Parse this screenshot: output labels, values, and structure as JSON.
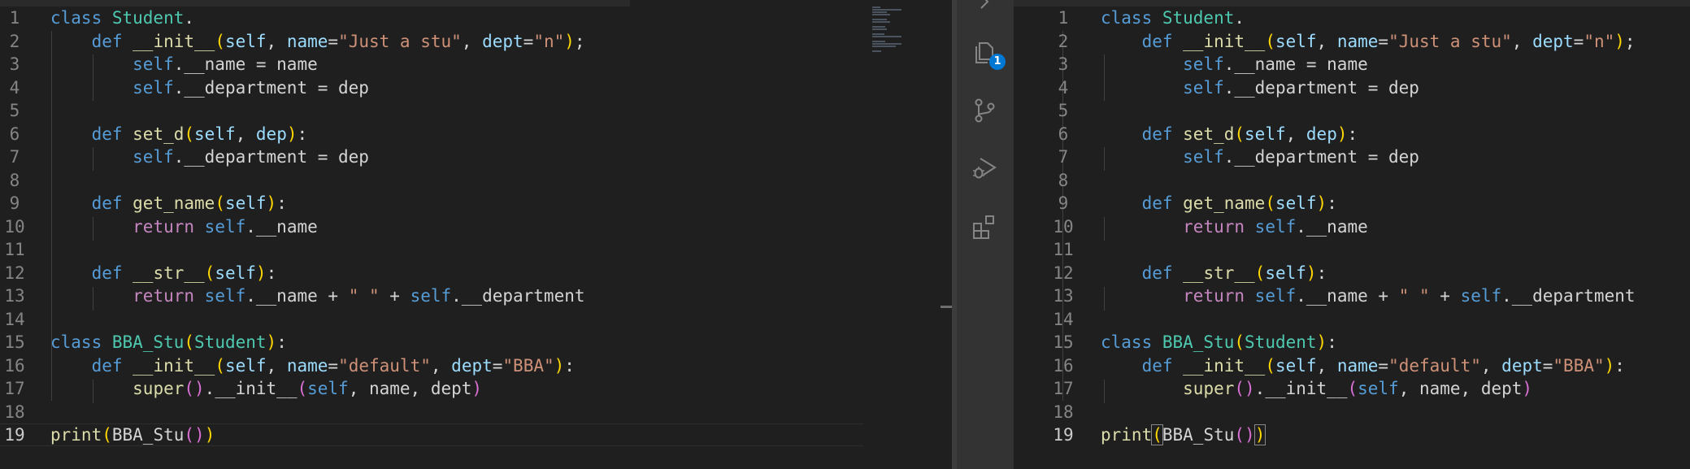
{
  "editor": {
    "lines": [
      {
        "n": "1",
        "t": [
          [
            "kw",
            "class "
          ],
          [
            "cls",
            "Student"
          ],
          [
            "",
            "."
          ]
        ]
      },
      {
        "n": "2",
        "t": [
          [
            "",
            "    "
          ],
          [
            "kw",
            "def "
          ],
          [
            "fn",
            "__init__"
          ],
          [
            "b1",
            "("
          ],
          [
            "prm",
            "self"
          ],
          [
            "",
            ", "
          ],
          [
            "prm",
            "name"
          ],
          [
            "",
            "="
          ],
          [
            "str",
            "\"Just a stu\""
          ],
          [
            "",
            ", "
          ],
          [
            "prm",
            "dept"
          ],
          [
            "",
            "="
          ],
          [
            "str",
            "\"n\""
          ],
          [
            "b1",
            ")"
          ],
          [
            "",
            ";"
          ]
        ]
      },
      {
        "n": "3",
        "t": [
          [
            "",
            "        "
          ],
          [
            "kw",
            "self"
          ],
          [
            "",
            ".__name = name"
          ]
        ]
      },
      {
        "n": "4",
        "t": [
          [
            "",
            "        "
          ],
          [
            "kw",
            "self"
          ],
          [
            "",
            ".__department = dep"
          ]
        ]
      },
      {
        "n": "5",
        "t": []
      },
      {
        "n": "6",
        "t": [
          [
            "",
            "    "
          ],
          [
            "kw",
            "def "
          ],
          [
            "fn",
            "set_d"
          ],
          [
            "b1",
            "("
          ],
          [
            "prm",
            "self"
          ],
          [
            "",
            ", "
          ],
          [
            "prm",
            "dep"
          ],
          [
            "b1",
            ")"
          ],
          [
            "",
            ":"
          ]
        ]
      },
      {
        "n": "7",
        "t": [
          [
            "",
            "        "
          ],
          [
            "kw",
            "self"
          ],
          [
            "",
            ".__department = dep"
          ]
        ]
      },
      {
        "n": "8",
        "t": []
      },
      {
        "n": "9",
        "t": [
          [
            "",
            "    "
          ],
          [
            "kw",
            "def "
          ],
          [
            "fn",
            "get_name"
          ],
          [
            "b1",
            "("
          ],
          [
            "prm",
            "self"
          ],
          [
            "b1",
            ")"
          ],
          [
            "",
            ":"
          ]
        ]
      },
      {
        "n": "10",
        "t": [
          [
            "",
            "        "
          ],
          [
            "ctl",
            "return "
          ],
          [
            "kw",
            "self"
          ],
          [
            "",
            ".__name"
          ]
        ]
      },
      {
        "n": "11",
        "t": []
      },
      {
        "n": "12",
        "t": [
          [
            "",
            "    "
          ],
          [
            "kw",
            "def "
          ],
          [
            "fn",
            "__str__"
          ],
          [
            "b1",
            "("
          ],
          [
            "prm",
            "self"
          ],
          [
            "b1",
            ")"
          ],
          [
            "",
            ":"
          ]
        ]
      },
      {
        "n": "13",
        "t": [
          [
            "",
            "        "
          ],
          [
            "ctl",
            "return "
          ],
          [
            "kw",
            "self"
          ],
          [
            "",
            ".__name + "
          ],
          [
            "str",
            "\" \""
          ],
          [
            "",
            " + "
          ],
          [
            "kw",
            "self"
          ],
          [
            "",
            ".__department"
          ]
        ]
      },
      {
        "n": "14",
        "t": []
      },
      {
        "n": "15",
        "t": [
          [
            "kw",
            "class "
          ],
          [
            "cls",
            "BBA_Stu"
          ],
          [
            "b1",
            "("
          ],
          [
            "cls",
            "Student"
          ],
          [
            "b1",
            ")"
          ],
          [
            "",
            ":"
          ]
        ]
      },
      {
        "n": "16",
        "t": [
          [
            "",
            "    "
          ],
          [
            "kw",
            "def "
          ],
          [
            "fn",
            "__init__"
          ],
          [
            "b1",
            "("
          ],
          [
            "prm",
            "self"
          ],
          [
            "",
            ", "
          ],
          [
            "prm",
            "name"
          ],
          [
            "",
            "="
          ],
          [
            "str",
            "\"default\""
          ],
          [
            "",
            ", "
          ],
          [
            "prm",
            "dept"
          ],
          [
            "",
            "="
          ],
          [
            "str",
            "\"BBA\""
          ],
          [
            "b1",
            ")"
          ],
          [
            "",
            ":"
          ]
        ]
      },
      {
        "n": "17",
        "t": [
          [
            "",
            "        "
          ],
          [
            "fn",
            "super"
          ],
          [
            "b2",
            "()"
          ],
          [
            "",
            ".__init__"
          ],
          [
            "b2",
            "("
          ],
          [
            "kw",
            "self"
          ],
          [
            "",
            ", name, dept"
          ],
          [
            "b2",
            ")"
          ]
        ]
      },
      {
        "n": "18",
        "t": []
      },
      {
        "n": "19",
        "t": [
          [
            "fn",
            "print"
          ],
          [
            "b1",
            "("
          ],
          [
            "",
            "BBA_Stu"
          ],
          [
            "b2",
            "()"
          ],
          [
            "b1",
            ")"
          ]
        ]
      }
    ],
    "current_line": "19"
  },
  "activity_bar": {
    "items": [
      {
        "name": "chevron-right-icon"
      },
      {
        "name": "explorer-icon"
      },
      {
        "name": "source-control-icon"
      },
      {
        "name": "run-debug-icon"
      },
      {
        "name": "extensions-icon"
      }
    ],
    "explorer_badge": "1"
  },
  "colors": {
    "editor_bg": "#1f1f1f",
    "activity_bg": "#333333",
    "keyword": "#569cd6",
    "control": "#c586c0",
    "class": "#4ec9b0",
    "function": "#dcdcaa",
    "param": "#9cdcfe",
    "string": "#ce9178",
    "badge": "#0078d4"
  }
}
